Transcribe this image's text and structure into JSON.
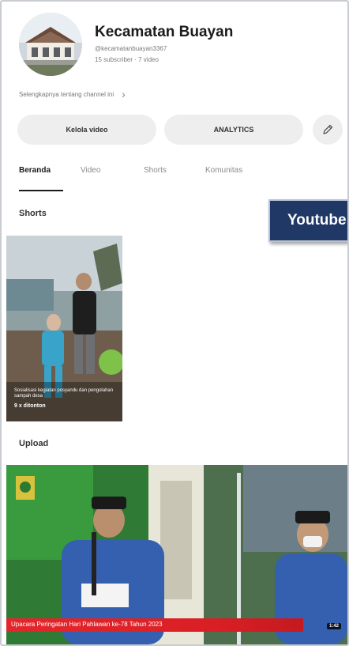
{
  "channel": {
    "name": "Kecamatan Buayan",
    "handle": "@kecamatanbuayan3367",
    "stats": "15 subscriber · 7 video",
    "more_info": "Selengkapnya tentang channel ini"
  },
  "actions": {
    "manage_videos": "Kelola video",
    "analytics": "ANALYTICS"
  },
  "tabs": [
    {
      "label": "Beranda",
      "active": true
    },
    {
      "label": "Video",
      "active": false
    },
    {
      "label": "Shorts",
      "active": false
    },
    {
      "label": "Komunitas",
      "active": false
    }
  ],
  "shorts_section": {
    "heading": "Shorts",
    "item": {
      "caption": "Sosialisasi kegiatan posyandu dan pengolahan sampah desa",
      "views": "9 x ditonton"
    }
  },
  "banner": {
    "text": "Youtube"
  },
  "upload_section": {
    "heading": "Upload",
    "video": {
      "title": "Upacara Peringatan Hari Pahlawan ke-78 Tahun 2023",
      "duration": "1:42"
    }
  },
  "colors": {
    "banner_bg": "#1f3866",
    "title_bar": "#e3262b",
    "button_bg": "#eeeeee"
  }
}
